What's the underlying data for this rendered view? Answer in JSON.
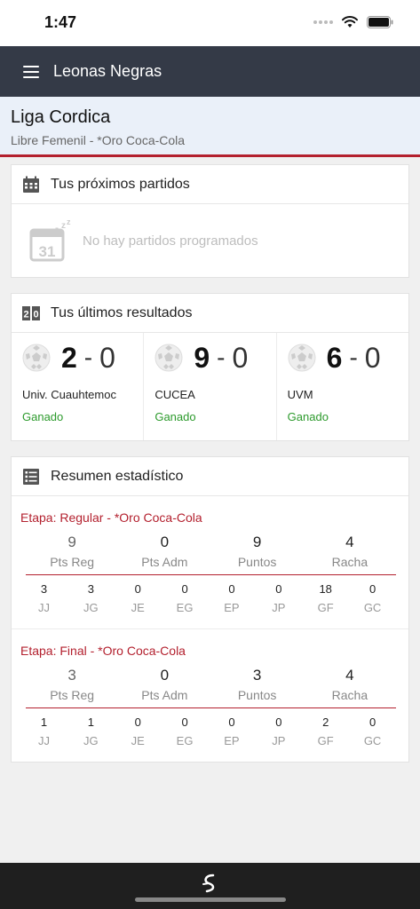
{
  "status_bar": {
    "time": "1:47"
  },
  "header": {
    "title": "Leonas Negras"
  },
  "league": {
    "name": "Liga Cordica",
    "subtitle": "Libre Femenil - *Oro Coca-Cola"
  },
  "next_matches": {
    "title": "Tus próximos partidos",
    "empty_text": "No hay partidos programados",
    "calendar_day": "31"
  },
  "last_results": {
    "title": "Tus últimos resultados",
    "icon_text": [
      "2",
      "0"
    ],
    "items": [
      {
        "score": "2",
        "sep": "-",
        "opp": "0",
        "team": "Univ. Cuauhtemoc",
        "status": "Ganado"
      },
      {
        "score": "9",
        "sep": "-",
        "opp": "0",
        "team": "CUCEA",
        "status": "Ganado"
      },
      {
        "score": "6",
        "sep": "-",
        "opp": "0",
        "team": "UVM",
        "status": "Ganado"
      }
    ]
  },
  "stats": {
    "title": "Resumen estadístico",
    "stages": [
      {
        "title": "Etapa: Regular - *Oro Coca-Cola",
        "big": [
          {
            "value": "9",
            "label": "Pts Reg"
          },
          {
            "value": "0",
            "label": "Pts Adm"
          },
          {
            "value": "9",
            "label": "Puntos"
          },
          {
            "value": "4",
            "label": "Racha"
          }
        ],
        "small": [
          {
            "value": "3",
            "label": "JJ"
          },
          {
            "value": "3",
            "label": "JG"
          },
          {
            "value": "0",
            "label": "JE"
          },
          {
            "value": "0",
            "label": "EG"
          },
          {
            "value": "0",
            "label": "EP"
          },
          {
            "value": "0",
            "label": "JP"
          },
          {
            "value": "18",
            "label": "GF"
          },
          {
            "value": "0",
            "label": "GC"
          }
        ]
      },
      {
        "title": "Etapa: Final - *Oro Coca-Cola",
        "big": [
          {
            "value": "3",
            "label": "Pts Reg"
          },
          {
            "value": "0",
            "label": "Pts Adm"
          },
          {
            "value": "3",
            "label": "Puntos"
          },
          {
            "value": "4",
            "label": "Racha"
          }
        ],
        "small": [
          {
            "value": "1",
            "label": "JJ"
          },
          {
            "value": "1",
            "label": "JG"
          },
          {
            "value": "0",
            "label": "JE"
          },
          {
            "value": "0",
            "label": "EG"
          },
          {
            "value": "0",
            "label": "EP"
          },
          {
            "value": "0",
            "label": "JP"
          },
          {
            "value": "2",
            "label": "GF"
          },
          {
            "value": "0",
            "label": "GC"
          }
        ]
      }
    ]
  },
  "colors": {
    "accent": "#b3202e",
    "header_bg": "#343a47",
    "win": "#2c9a2c"
  }
}
